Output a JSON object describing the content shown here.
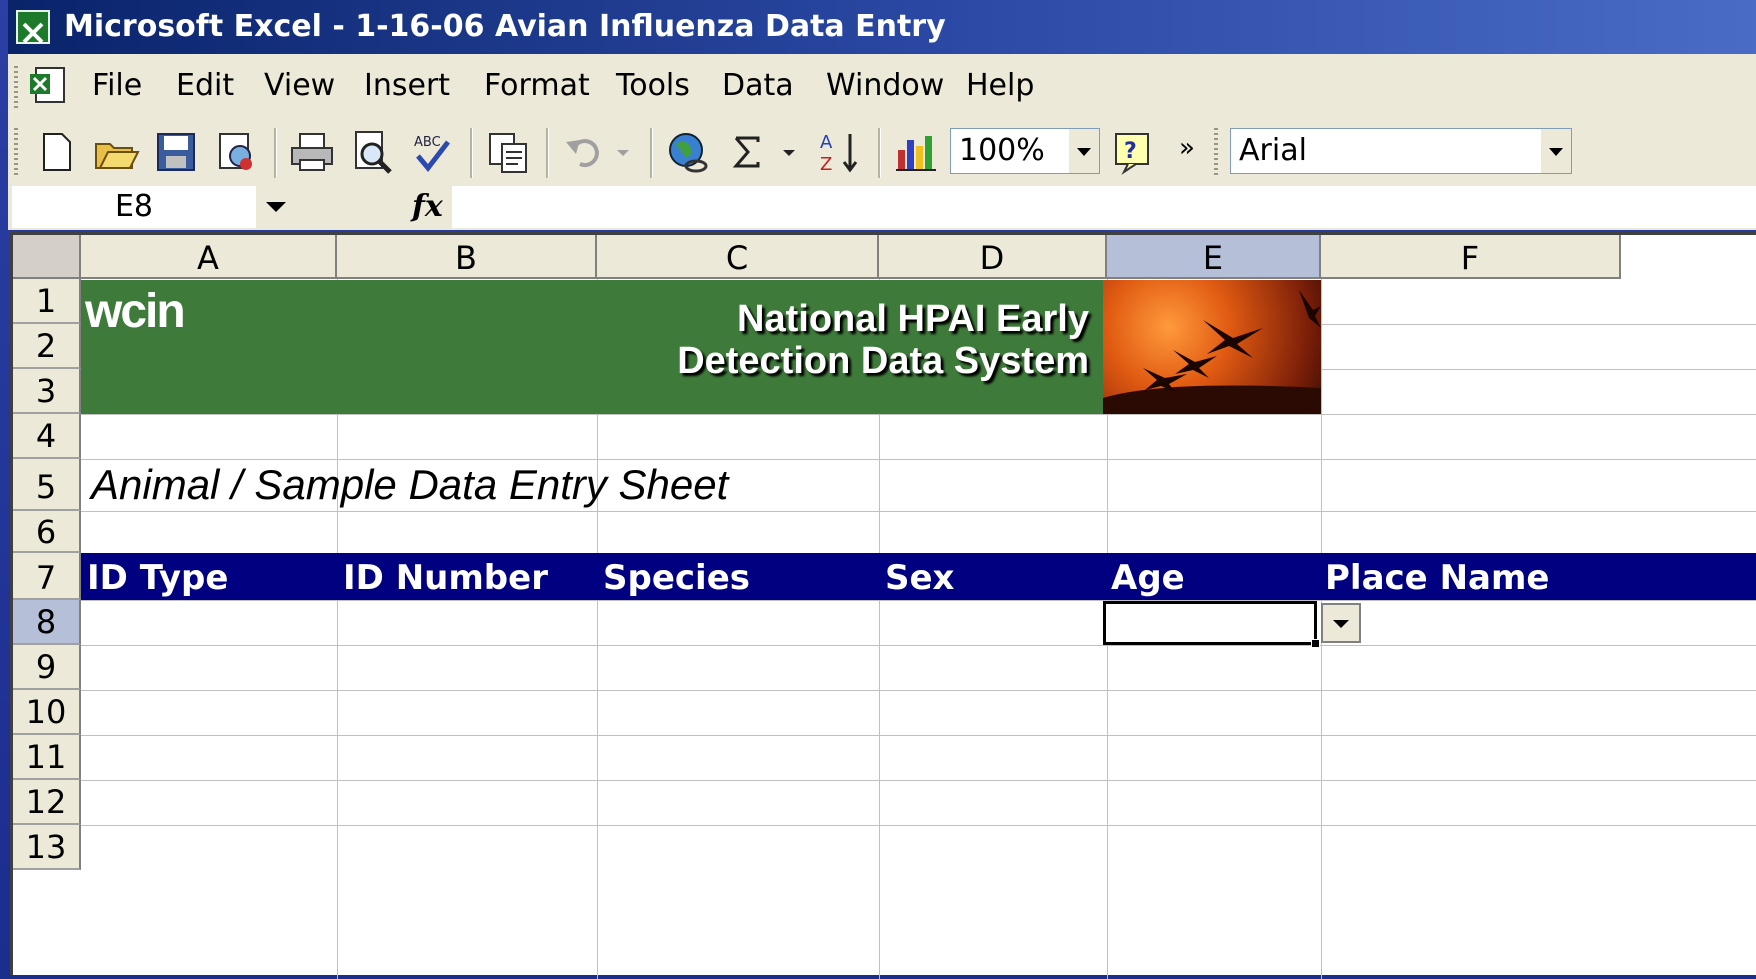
{
  "window": {
    "title": "Microsoft Excel - 1-16-06 Avian Influenza Data Entry"
  },
  "menu": [
    "File",
    "Edit",
    "View",
    "Insert",
    "Format",
    "Tools",
    "Data",
    "Window",
    "Help"
  ],
  "toolbar": {
    "zoom": "100%",
    "font": "Arial",
    "more": "»"
  },
  "formula_bar": {
    "name_box": "E8",
    "fx_label": "fx",
    "formula": ""
  },
  "grid": {
    "columns": [
      "A",
      "B",
      "C",
      "D",
      "E",
      "F"
    ],
    "rows": [
      "1",
      "2",
      "3",
      "4",
      "5",
      "6",
      "7",
      "8",
      "9",
      "10",
      "11",
      "12",
      "13"
    ],
    "selected_column": "E",
    "selected_row": "8"
  },
  "banner": {
    "logo": "wcin",
    "title_line1": "National HPAI Early",
    "title_line2": "Detection Data System"
  },
  "sheet_title": "Animal / Sample Data Entry Sheet",
  "headers": [
    "ID Type",
    "ID Number",
    "Species",
    "Sex",
    "Age",
    "Place Name"
  ],
  "colors": {
    "title_bar": "#0a246a",
    "header_row": "#000080",
    "banner": "#3e7a3a"
  }
}
